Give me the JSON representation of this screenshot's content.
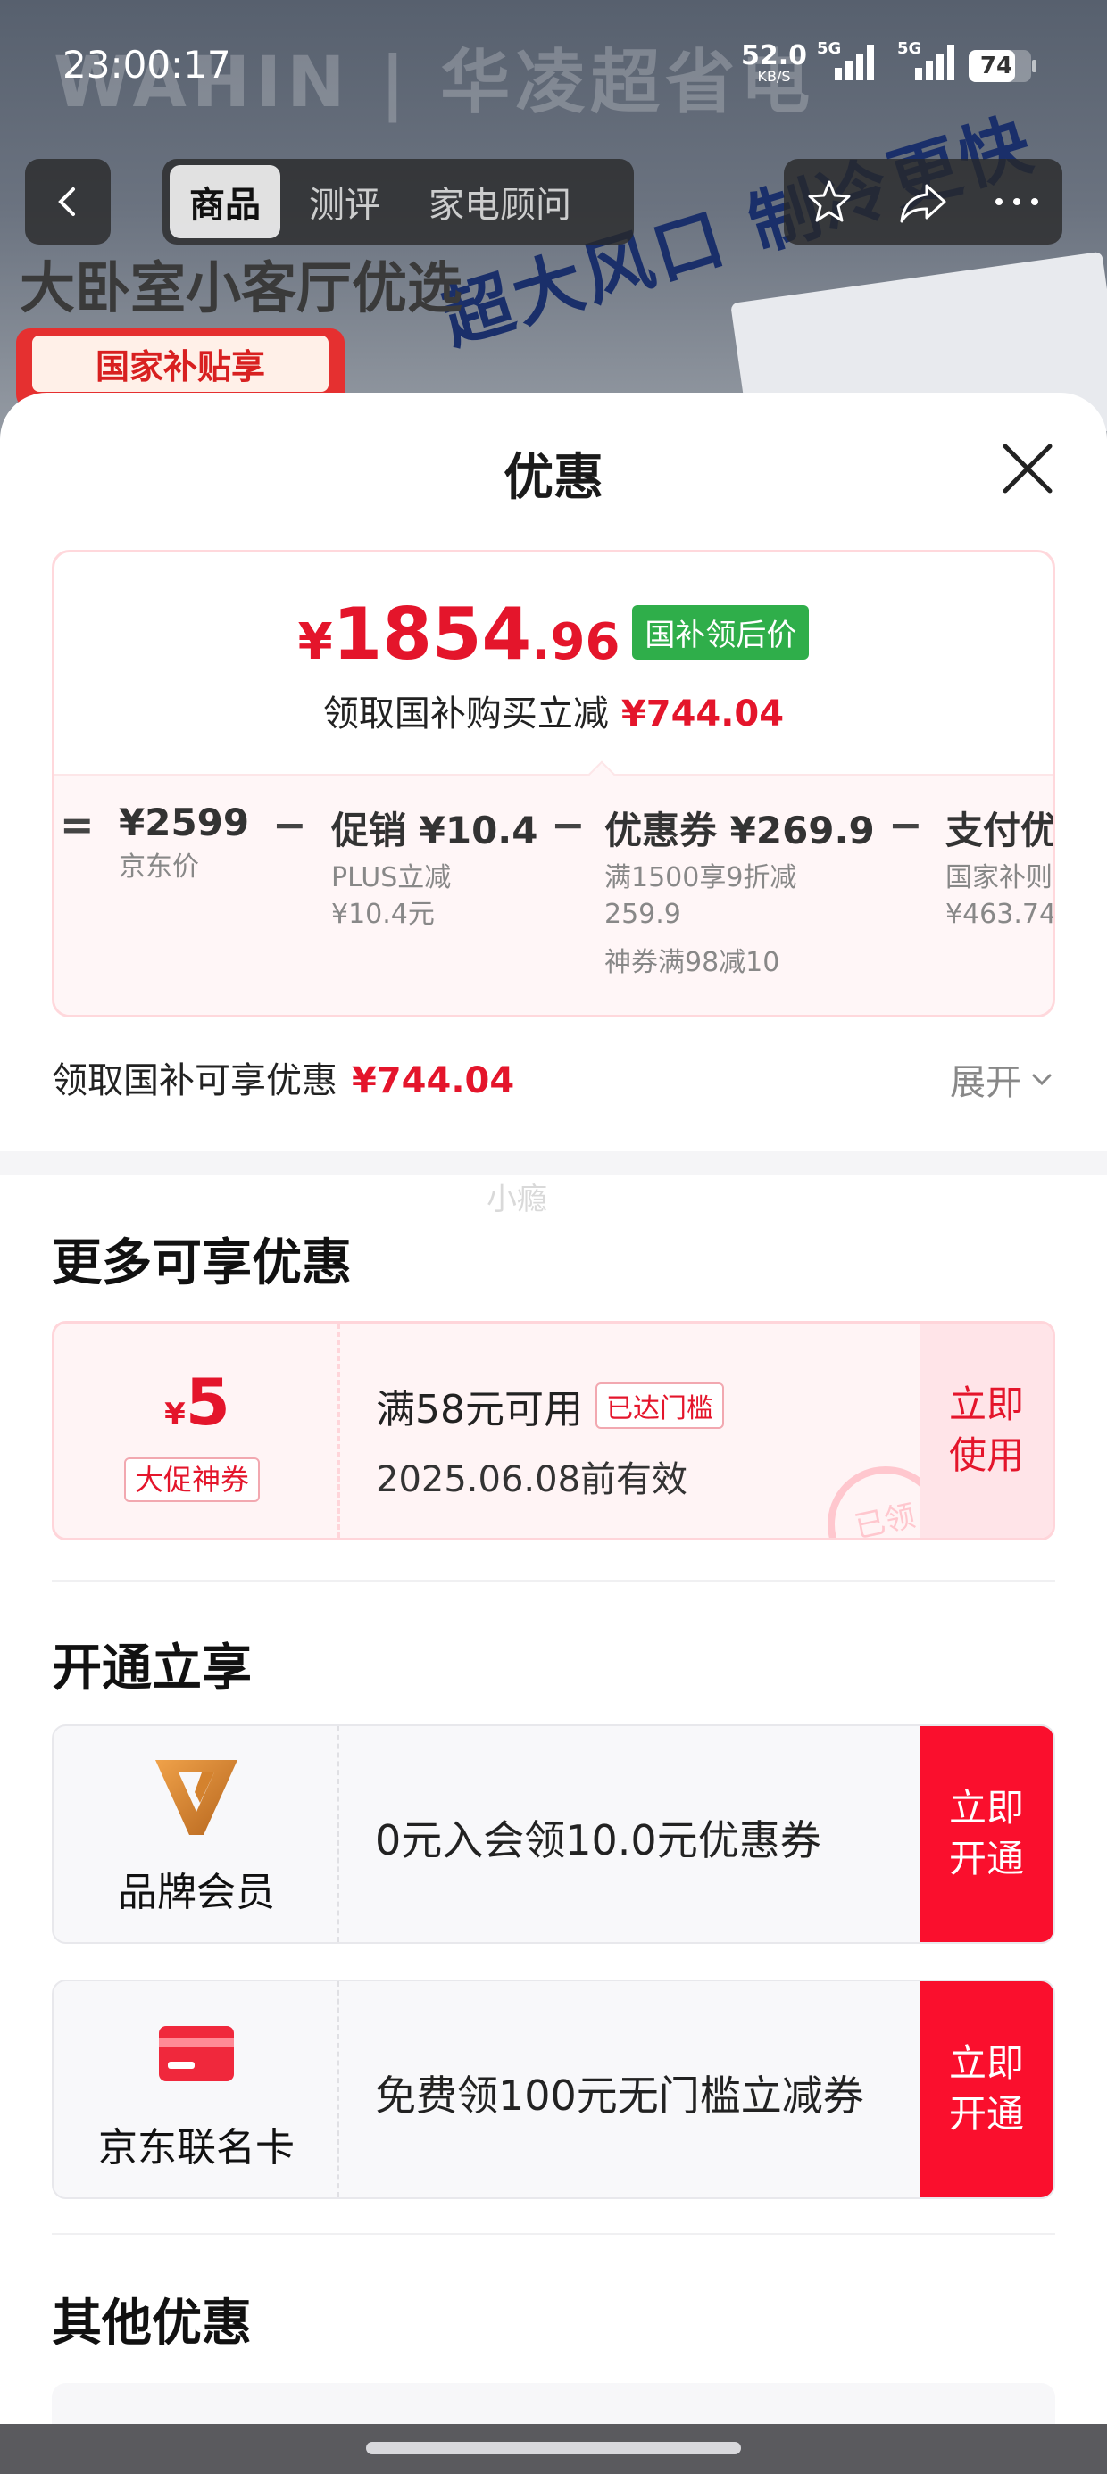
{
  "background": {
    "brand": "WAHIN | 华凌超省电",
    "headline": "大卧室小客厅优选",
    "subsidy_badge": "国家补贴享",
    "slogan": "超大风口 制冷更快"
  },
  "status_bar": {
    "time": "23:00:17",
    "net_speed_value": "52.0",
    "net_speed_unit": "KB/S",
    "sim1_label": "5G",
    "sim2_label": "5G",
    "battery": "74",
    "battery_level": 0.74
  },
  "nav": {
    "tabs": [
      {
        "label": "商品",
        "active": true
      },
      {
        "label": "测评",
        "active": false
      },
      {
        "label": "家电顾问",
        "active": false
      }
    ],
    "icons": [
      "back-arrow-icon",
      "star-icon",
      "share-icon",
      "more-icon"
    ]
  },
  "sheet": {
    "title": "优惠",
    "summary": {
      "final_price_symbol": "¥",
      "final_price_int": "1854",
      "final_price_dec": ".96",
      "final_price_tag": "国补领后价",
      "reduce_text": "领取国补购买立减",
      "reduce_amount": "¥744.04",
      "breakdown": [
        {
          "op": "=",
          "main": "¥2599",
          "sub": [
            "京东价"
          ]
        },
        {
          "op": "−",
          "main": "促销 ¥10.4",
          "sub": [
            "PLUS立减",
            "¥10.4元"
          ]
        },
        {
          "op": "−",
          "main": "优惠券 ¥269.9",
          "sub": [
            "满1500享9折减",
            "259.9",
            "神券满98减10"
          ]
        },
        {
          "op": "−",
          "main": "支付优",
          "sub": [
            "国家补则",
            "¥463.74"
          ]
        }
      ]
    },
    "discount_row": {
      "label": "领取国补可享优惠",
      "amount": "¥744.04",
      "expand": "展开"
    },
    "watermark": "小瘾",
    "more_section": {
      "title": "更多可享优惠",
      "coupon": {
        "symbol": "¥",
        "amount": "5",
        "type": "大促神券",
        "condition": "满58元可用",
        "reached": "已达门槛",
        "valid": "2025.06.08前有效",
        "button": "立即\n使用",
        "stamp": "已领"
      }
    },
    "member_section": {
      "title": "开通立享",
      "cards": [
        {
          "name": "品牌会员",
          "text": "0元入会领10.0元优惠券",
          "button": "立即\n开通",
          "icon": "brand-v-icon"
        },
        {
          "name": "京东联名卡",
          "text": "免费领100元无门槛立减券",
          "button": "立即\n开通",
          "icon": "card-icon"
        }
      ]
    },
    "other_section": {
      "title": "其他优惠"
    }
  },
  "colors": {
    "accent_red": "#e4152b",
    "tag_green": "#2fae4a",
    "button_red": "#fa0f2d"
  }
}
